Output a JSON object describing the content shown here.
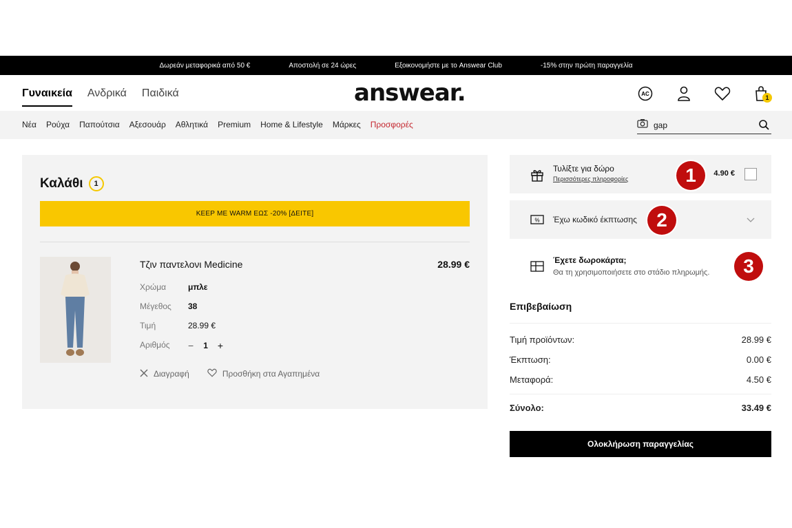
{
  "promo_bar": {
    "items": [
      "Δωρεάν μεταφορικά από 50 €",
      "Αποστολή σε 24 ώρες",
      "Εξοικονομήστε με το Answear Club",
      "-15% στην πρώτη παραγγελία"
    ]
  },
  "header": {
    "tabs": [
      {
        "label": "Γυναικεία",
        "active": true
      },
      {
        "label": "Ανδρικά",
        "active": false
      },
      {
        "label": "Παιδικά",
        "active": false
      }
    ],
    "logo": "answear.",
    "icons": [
      "ac-club-icon",
      "user-icon",
      "heart-icon",
      "bag-icon"
    ],
    "cart_count": "1"
  },
  "nav": {
    "items": [
      "Νέα",
      "Ρούχα",
      "Παπούτσια",
      "Αξεσουάρ",
      "Αθλητικά",
      "Premium",
      "Home & Lifestyle",
      "Μάρκες",
      "Προσφορές"
    ],
    "sale_color": "#c4262e",
    "search": {
      "value": "gap"
    }
  },
  "cart": {
    "title": "Καλάθι",
    "count": "1",
    "promo_banner": "KEEP ME WARM ΕΩΣ -20% [ΔΕΙΤΕ]",
    "item": {
      "name": "Τζιν παντελονι Medicine",
      "price": "28.99 €",
      "attributes": [
        {
          "label": "Χρώμα",
          "value": "μπλε"
        },
        {
          "label": "Μέγεθος",
          "value": "38"
        },
        {
          "label": "Τιμή",
          "value": "28.99 €"
        }
      ],
      "quantity_label": "Αριθμός",
      "quantity_minus": "−",
      "quantity": "1",
      "quantity_plus": "+",
      "delete_label": "Διαγραφή",
      "wishlist_label": "Προσθήκη στα Αγαπημένα"
    }
  },
  "sidebar": {
    "gift_wrap": {
      "title": "Τυλίξτε για δώρο",
      "link": "Περισσότερες πληροφορίες",
      "price": "4.90 €"
    },
    "coupon": {
      "label": "Έχω κωδικό έκπτωσης"
    },
    "gift_card": {
      "title": "Έχετε δωροκάρτα;",
      "subtitle": "Θα τη χρησιμοποιήσετε στο στάδιο πληρωμής."
    }
  },
  "annotations": [
    "1",
    "2",
    "3"
  ],
  "summary": {
    "title": "Επιβεβαίωση",
    "rows": [
      {
        "label": "Τιμή προϊόντων:",
        "value": "28.99 €"
      },
      {
        "label": "Έκπτωση:",
        "value": "0.00 €"
      },
      {
        "label": "Μεταφορά:",
        "value": "4.50 €"
      }
    ],
    "total_label": "Σύνολο:",
    "total_value": "33.49 €",
    "checkout_label": "Ολοκλήρωση παραγγελίας"
  },
  "colors": {
    "accent_yellow": "#f9c700",
    "annotation_red": "#c00d0d",
    "black": "#000000"
  }
}
